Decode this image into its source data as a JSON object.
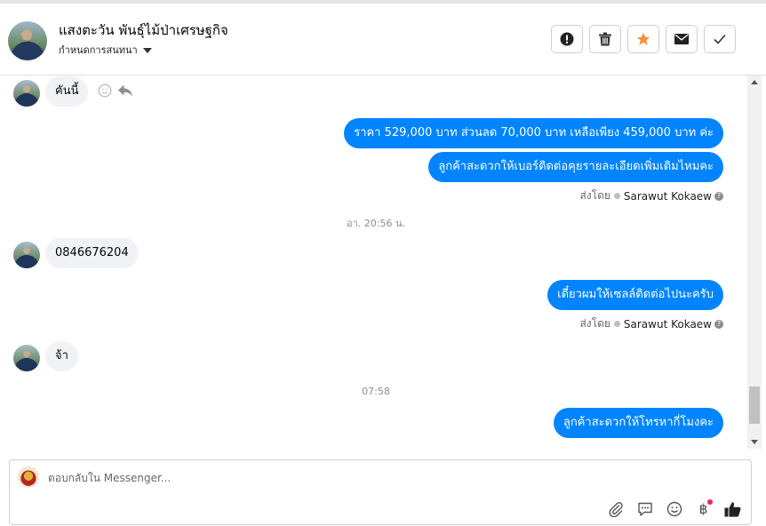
{
  "header": {
    "contact_name": "แสงตะวัน พันธุ์ไม้ป่าเศรษฐกิจ",
    "subtitle": "กำหนดการสนทนา",
    "actions": [
      {
        "name": "report-button",
        "icon": "exclamation-circle-icon"
      },
      {
        "name": "delete-button",
        "icon": "trash-icon"
      },
      {
        "name": "star-button",
        "icon": "star-icon"
      },
      {
        "name": "mark-unread-button",
        "icon": "envelope-icon"
      },
      {
        "name": "done-button",
        "icon": "checkmark-icon"
      }
    ]
  },
  "messages": {
    "m1": "คันนี้",
    "m2": "ราคา 529,000 บาท ส่วนลด 70,000 บาท เหลือเพียง 459,000 บาท ค่ะ",
    "m3": "ลูกค้าสะดวกให้เบอร์ติดต่อคุยรายละเอียดเพิ่มเติมไหมคะ",
    "sent1_prefix": "ส่งโดย",
    "sent1_name": "Sarawut Kokaew",
    "ts1": "อา. 20:56 น.",
    "m4": "0846676204",
    "m5": "เดี๋ยวผมให้เซลล์ติดต่อไปนะครับ",
    "sent2_prefix": "ส่งโดย",
    "sent2_name": "Sarawut Kokaew",
    "m6": "จ้า",
    "ts2": "07:58",
    "m7": "ลูกค้าสะดวกให้โทรหากี่โมงคะ"
  },
  "composer": {
    "placeholder": "ตอบกลับใน Messenger...",
    "tools": [
      "paperclip-icon",
      "saved-reply-icon",
      "emoji-icon",
      "baht-payment-icon",
      "thumbs-up-icon"
    ],
    "baht_symbol": "฿"
  },
  "colors": {
    "outgoing_bubble": "#0084ff",
    "incoming_bubble": "#f0f2f5",
    "star": "#f7923a"
  }
}
